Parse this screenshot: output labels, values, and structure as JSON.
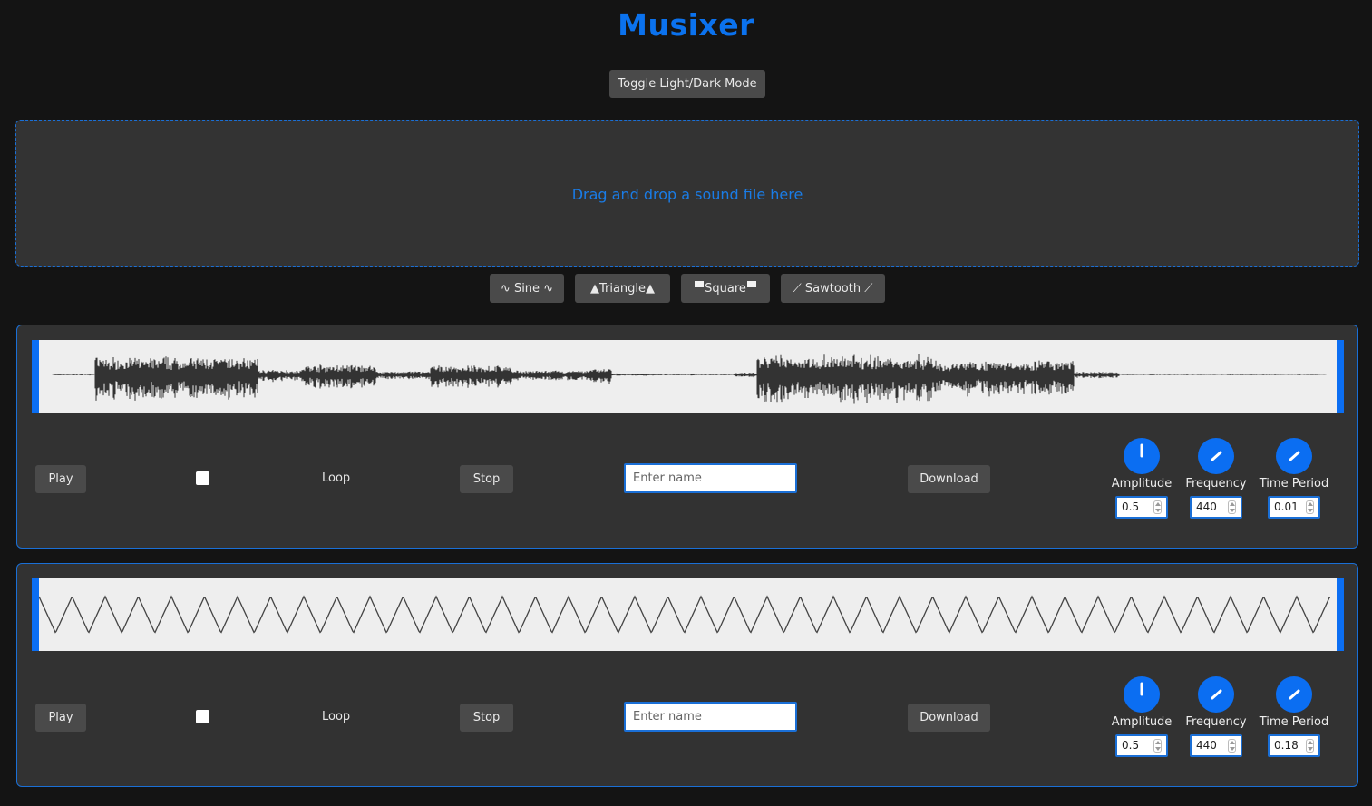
{
  "app": {
    "title": "Musixer",
    "toggle_label": "Toggle Light/Dark Mode",
    "accent": "#0b6ef2"
  },
  "dropzone": {
    "text": "Drag and drop a sound file here"
  },
  "waveform_buttons": {
    "sine": "∿ Sine ∿",
    "triangle": "Triangle",
    "triangle_icon": "▲",
    "square": "Square",
    "sawtooth": "⟋ Sawtooth ⟋"
  },
  "tracks": [
    {
      "waveform_kind": "recorded audio",
      "play_label": "Play",
      "loop_label": "Loop",
      "loop_checked": false,
      "stop_label": "Stop",
      "name_placeholder": "Enter name",
      "name_value": "",
      "download_label": "Download",
      "knobs": [
        {
          "label": "Amplitude",
          "value": "0.5"
        },
        {
          "label": "Frequency",
          "value": "440"
        },
        {
          "label": "Time Period",
          "value": "0.01"
        }
      ]
    },
    {
      "waveform_kind": "triangle wave",
      "play_label": "Play",
      "loop_label": "Loop",
      "loop_checked": false,
      "stop_label": "Stop",
      "name_placeholder": "Enter name",
      "name_value": "",
      "download_label": "Download",
      "knobs": [
        {
          "label": "Amplitude",
          "value": "0.5"
        },
        {
          "label": "Frequency",
          "value": "440"
        },
        {
          "label": "Time Period",
          "value": "0.18"
        }
      ]
    }
  ]
}
